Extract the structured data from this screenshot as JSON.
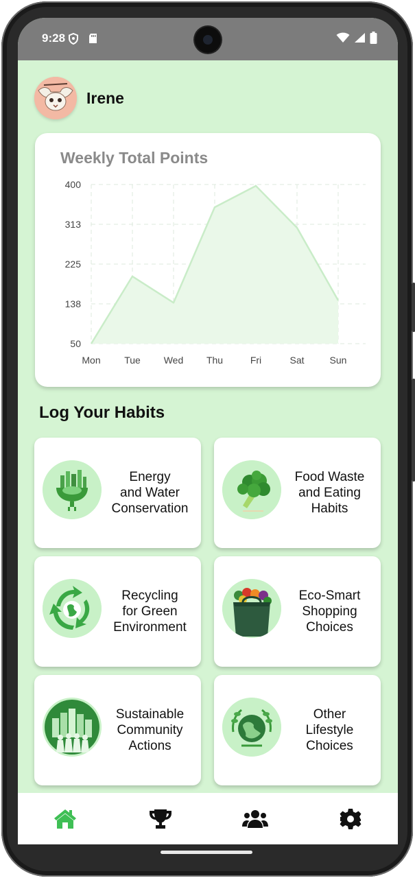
{
  "status_bar": {
    "time": "9:28"
  },
  "user": {
    "name": "Irene"
  },
  "chart_data": {
    "type": "area",
    "title": "Weekly Total Points",
    "categories": [
      "Mon",
      "Tue",
      "Wed",
      "Thu",
      "Fri",
      "Sat",
      "Sun"
    ],
    "values": [
      50,
      198,
      140,
      350,
      397,
      305,
      145
    ],
    "ytick_labels": [
      "400",
      "313",
      "225",
      "138",
      "50"
    ],
    "ylim": [
      50,
      400
    ],
    "grid": true,
    "colors": {
      "line": "#c9ecc8",
      "fill": "#eaf8e9",
      "grid": "#dde8dd"
    }
  },
  "section": {
    "title": "Log Your Habits"
  },
  "habits": [
    {
      "label": "Energy\nand Water\nConservation",
      "icon": "energy-water-icon"
    },
    {
      "label": "Food Waste\nand Eating\nHabits",
      "icon": "broccoli-icon"
    },
    {
      "label": "Recycling\nfor Green\nEnvironment",
      "icon": "recycle-globe-icon"
    },
    {
      "label": "Eco-Smart\nShopping\nChoices",
      "icon": "shopping-bag-icon"
    },
    {
      "label": "Sustainable\nCommunity\nActions",
      "icon": "community-city-icon"
    },
    {
      "label": "Other\nLifestyle\nChoices",
      "icon": "eco-globe-icon"
    }
  ],
  "nav": [
    {
      "icon": "home-icon",
      "active": true
    },
    {
      "icon": "trophy-icon",
      "active": false
    },
    {
      "icon": "users-icon",
      "active": false
    },
    {
      "icon": "settings-gear-icon",
      "active": false
    }
  ],
  "colors": {
    "background": "#d5f4d3",
    "accent": "#3fbf55",
    "icon_bg": "#c8f1c7"
  }
}
